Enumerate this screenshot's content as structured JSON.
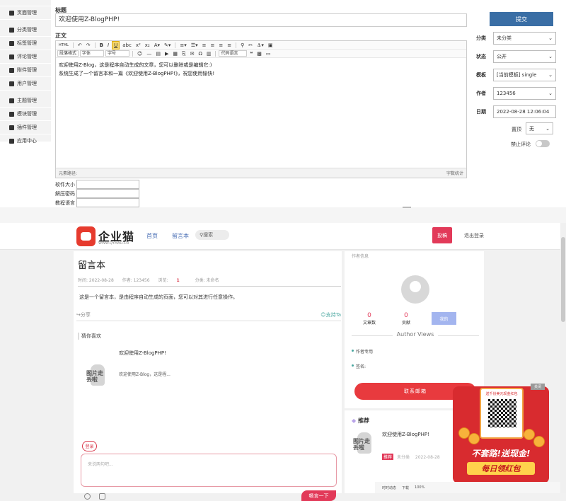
{
  "admin": {
    "sidebar": {
      "items": [
        {
          "label": "页面管理",
          "icon": "page-icon"
        },
        {
          "label": "分类管理",
          "icon": "folder-icon"
        },
        {
          "label": "标签管理",
          "icon": "tag-icon"
        },
        {
          "label": "评论管理",
          "icon": "comment-icon"
        },
        {
          "label": "附件管理",
          "icon": "attachment-icon"
        },
        {
          "label": "用户管理",
          "icon": "user-icon"
        },
        {
          "label": "主题管理",
          "icon": "theme-icon"
        },
        {
          "label": "模块管理",
          "icon": "module-icon"
        },
        {
          "label": "插件管理",
          "icon": "plugin-icon"
        },
        {
          "label": "应用中心",
          "icon": "app-center-icon"
        }
      ]
    },
    "title_label": "标题",
    "title_value": "欢迎使用Z-BlogPHP!",
    "body_label": "正文",
    "toolbar": {
      "paragraph_format": "段落格式",
      "font": "字体",
      "font_size": "字号",
      "code_lang": "代码语言",
      "html": "HTML",
      "bold": "B",
      "italic": "I",
      "underline": "U"
    },
    "editor_lines": [
      "欢迎使用Z-Blog，这是程序自动生成的文章，您可以删除或是编辑它:)",
      "系统生成了一个留言本和一篇《欢迎使用Z-BlogPHP!》，祝您使用愉快!"
    ],
    "editor_status_left": "元素路径:",
    "editor_status_right": "字数统计",
    "extra_fields": [
      "软件大小",
      "解压密码",
      "教程语言"
    ],
    "submit_label": "提交",
    "props": [
      {
        "label": "分类",
        "value": "未分类"
      },
      {
        "label": "状态",
        "value": "公开"
      },
      {
        "label": "模板",
        "value": "[当前模板] single"
      },
      {
        "label": "作者",
        "value": "123456"
      }
    ],
    "date_label": "日期",
    "date_value": "2022-08-28 12:06:04",
    "pin_label": "置顶",
    "pin_value": "无",
    "disable_comment_label": "禁止评论",
    "disable_comment_on": false
  },
  "front": {
    "logo_text": "企业猫",
    "logo_sub": "WWW.QYMAO.CN",
    "nav": [
      "首页",
      "留言本"
    ],
    "search_label": "搜索",
    "post_label": "投稿",
    "logout_label": "退出登录",
    "article": {
      "title": "留言本",
      "time": "时间: 2022-08-28",
      "author": "作者: 123456",
      "views_label": "浏览:",
      "views_value": "1",
      "category": "分类: 未命名",
      "body": "这是一个留言本，是由程序自动生成的页面，您可以对其进行任意操作。",
      "share": "分享",
      "support": "支持Ta",
      "guess_head": "猜你喜欢",
      "guess_title": "欢迎使用Z-BlogPHP!",
      "guess_excerpt": "欢迎使用Z-Blog，这是程...",
      "thumb_text": "图片走丢啦",
      "login_badge": "登录",
      "comment_placeholder": "来说两句吧...",
      "submit_label": "畅言一下"
    },
    "author_box": {
      "head": "作者信息",
      "articles_count": "0",
      "articles_label": "文章数",
      "contrib_count": "0",
      "contrib_label": "贡献",
      "my_label": "我的",
      "views_title": "Author Views",
      "line1": "作者专用",
      "line2": "签名:",
      "contact_label": "联系邮箱"
    },
    "recommend": {
      "head": "推荐",
      "title": "欢迎使用Z-BlogPHP!",
      "tag": "推荐",
      "category": "未分类",
      "date": "2022-08-28"
    },
    "promo": {
      "close_label": "关闭",
      "qr_title": "送千份美元现金红包",
      "big_text": "不套路!送现金!",
      "sub_text": "每日领红包"
    },
    "statusbar": [
      "时时动态",
      "下载",
      "100%"
    ]
  }
}
